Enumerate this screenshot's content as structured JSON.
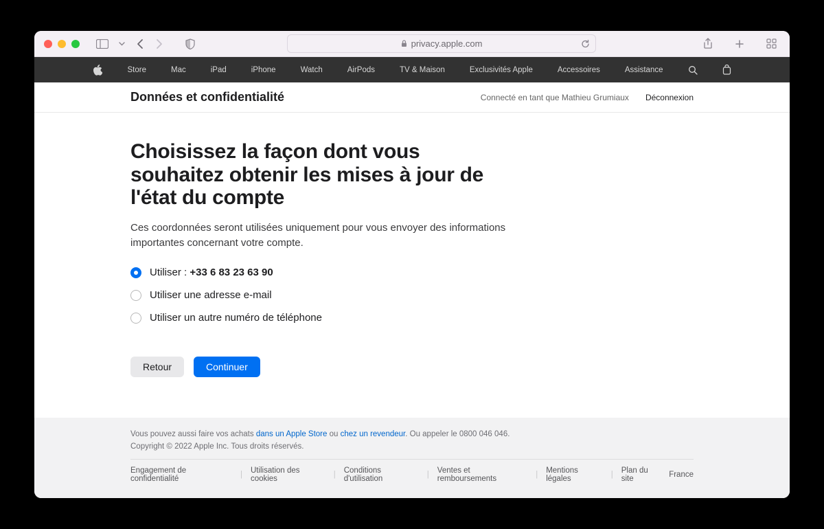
{
  "browser": {
    "url_host": "privacy.apple.com"
  },
  "apple_nav": {
    "items": [
      "Store",
      "Mac",
      "iPad",
      "iPhone",
      "Watch",
      "AirPods",
      "TV & Maison",
      "Exclusivités Apple",
      "Accessoires",
      "Assistance"
    ]
  },
  "local_header": {
    "title": "Données et confidentialité",
    "connected_as": "Connecté en tant que Mathieu Grumiaux",
    "signout": "Déconnexion"
  },
  "main": {
    "heading": "Choisissez la façon dont vous souhaitez obtenir les mises à jour de l'état du compte",
    "subtext": "Ces coordonnées seront utilisées uniquement pour vous envoyer des informations importantes concernant votre compte.",
    "options": [
      {
        "prefix": "Utiliser : ",
        "bold": "+33 6 83 23 63 90",
        "checked": true
      },
      {
        "prefix": "Utiliser une adresse e-mail",
        "bold": "",
        "checked": false
      },
      {
        "prefix": "Utiliser un autre numéro de téléphone",
        "bold": "",
        "checked": false
      }
    ],
    "back_label": "Retour",
    "continue_label": "Continuer"
  },
  "footer": {
    "line1_a": "Vous pouvez aussi faire vos achats ",
    "line1_link1": "dans un Apple Store",
    "line1_b": " ou ",
    "line1_link2": "chez un revendeur",
    "line1_c": ". Ou appeler le 0800 046 046.",
    "copyright": "Copyright © 2022 Apple Inc. Tous droits réservés.",
    "links": [
      "Engagement de confidentialité",
      "Utilisation des cookies",
      "Conditions d'utilisation",
      "Ventes et remboursements",
      "Mentions légales",
      "Plan du site"
    ],
    "region": "France"
  }
}
